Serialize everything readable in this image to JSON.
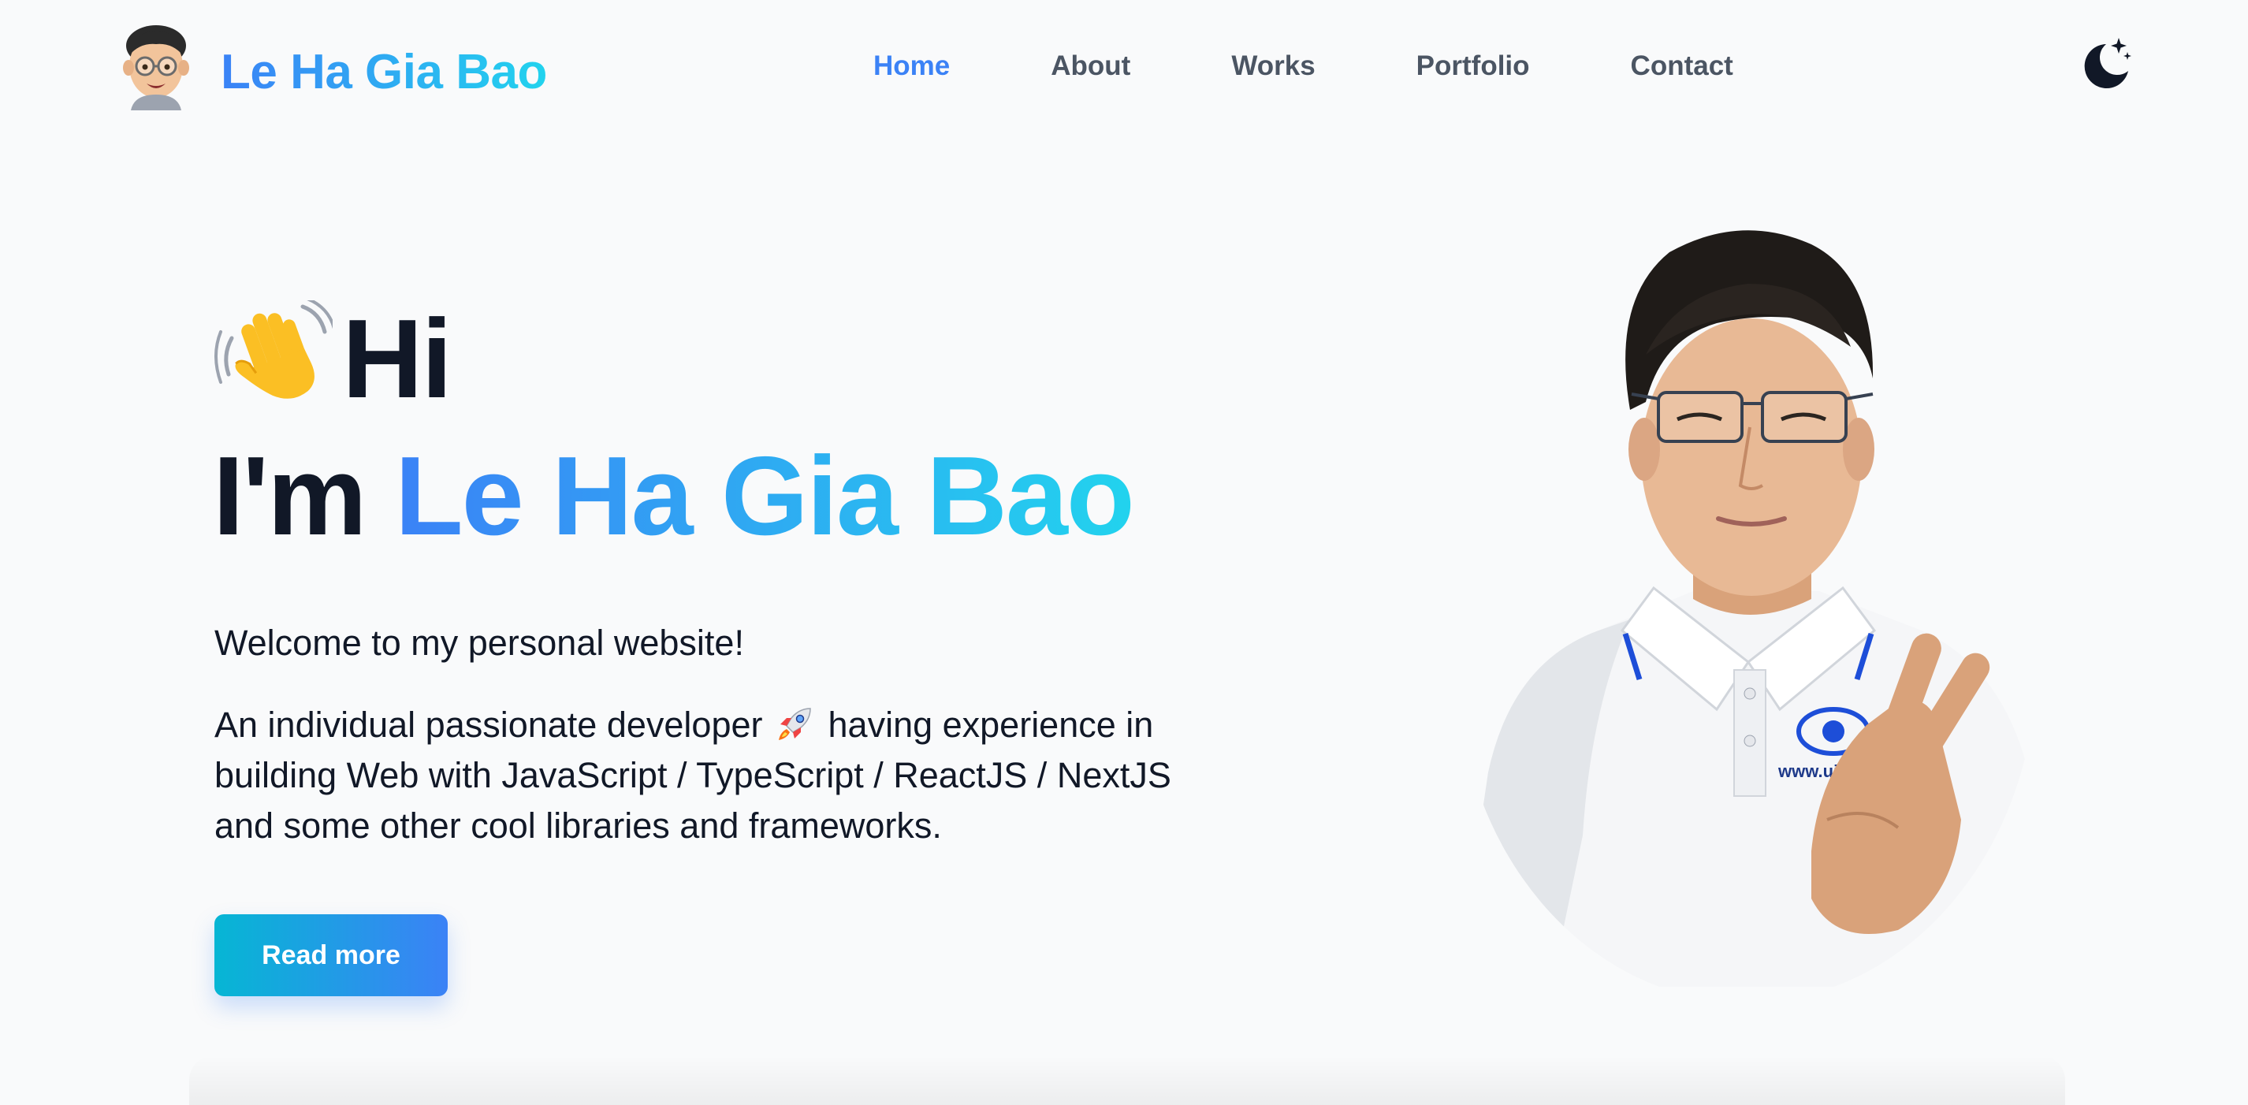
{
  "header": {
    "brand_name": "Le Ha Gia Bao",
    "nav": [
      {
        "label": "Home",
        "active": true
      },
      {
        "label": "About",
        "active": false
      },
      {
        "label": "Works",
        "active": false
      },
      {
        "label": "Portfolio",
        "active": false
      },
      {
        "label": "Contact",
        "active": false
      }
    ],
    "theme_toggle_icon": "moon-stars-icon"
  },
  "hero": {
    "greeting": "Hi",
    "greeting_icon": "waving-hand-icon",
    "im_prefix": "I'm",
    "name": "Le Ha Gia Bao",
    "welcome": "Welcome to my personal website!",
    "intro_before_icon": "An individual passionate developer",
    "intro_icon": "rocket-icon",
    "intro_after_icon": "having experience in building Web with JavaScript / TypeScript / ReactJS / NextJS and some other cool libraries and frameworks.",
    "cta_label": "Read more",
    "portrait_shirt_text": "www.uit.edu."
  },
  "colors": {
    "background": "#f9fafb",
    "text": "#111827",
    "nav_text": "#4b5563",
    "accent_blue": "#3b82f6",
    "accent_cyan": "#22d3ee",
    "button_start": "#06b6d4",
    "button_end": "#3b82f6"
  }
}
